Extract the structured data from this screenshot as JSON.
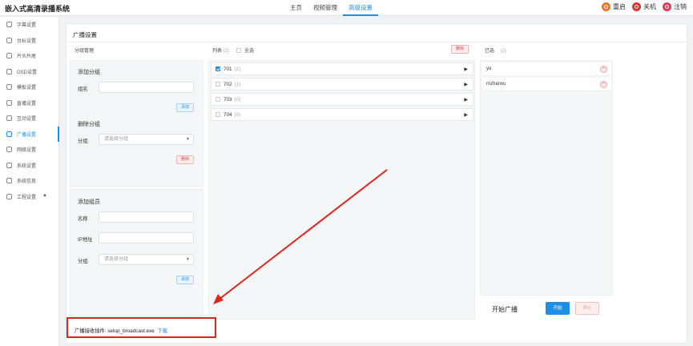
{
  "app": {
    "title": "嵌入式高清录播系统"
  },
  "topnav": {
    "items": [
      "主页",
      "视频管理",
      "高级设置"
    ],
    "active_index": 2
  },
  "actions": {
    "restart": "重启",
    "shutdown": "关机",
    "logout": "注销"
  },
  "sidebar": {
    "items": [
      "字幕设置",
      "台标设置",
      "片头片尾",
      "OSD设置",
      "模板设置",
      "直播设置",
      "互动设置",
      "广播设置",
      "网络设置",
      "系统设置",
      "系统信息",
      "工程设置"
    ],
    "active_index": 7
  },
  "panel": {
    "title": "广播设置"
  },
  "group_mgmt": {
    "label": "分组管理",
    "add_group": {
      "title": "添加分组",
      "name_label": "组名",
      "add_button": "添加"
    },
    "del_group": {
      "title": "删除分组",
      "group_label": "分组",
      "group_placeholder": "请选择分组",
      "delete_button": "删除"
    },
    "add_member": {
      "title": "添加组员",
      "name_label": "名称",
      "ip_label": "IP地址",
      "group_label": "分组",
      "group_placeholder": "请选择分组",
      "add_button": "添加"
    }
  },
  "list": {
    "label": "列表",
    "count": "(2)",
    "select_all": "全选",
    "delete_button": "删除",
    "items": [
      {
        "name": "701",
        "count": "(2)",
        "checked": true
      },
      {
        "name": "702",
        "count": "(1)",
        "checked": false
      },
      {
        "name": "703",
        "count": "(0)",
        "checked": false
      },
      {
        "name": "704",
        "count": "(0)",
        "checked": false
      }
    ]
  },
  "selected": {
    "label": "已选",
    "count": "(2)",
    "items": [
      "yu",
      "mzhanxu"
    ]
  },
  "broadcast": {
    "label": "开始广播",
    "start_button": "开始",
    "stop_button": "停止"
  },
  "plugin": {
    "text": "广播接收插件: setup_broadcast.exe",
    "download_link": "下载"
  },
  "colors": {
    "accent": "#1e8fe8",
    "annotation_red": "#e0251b"
  },
  "icons": {
    "restart": "restart-icon",
    "shutdown": "power-icon",
    "logout": "logout-icon"
  }
}
